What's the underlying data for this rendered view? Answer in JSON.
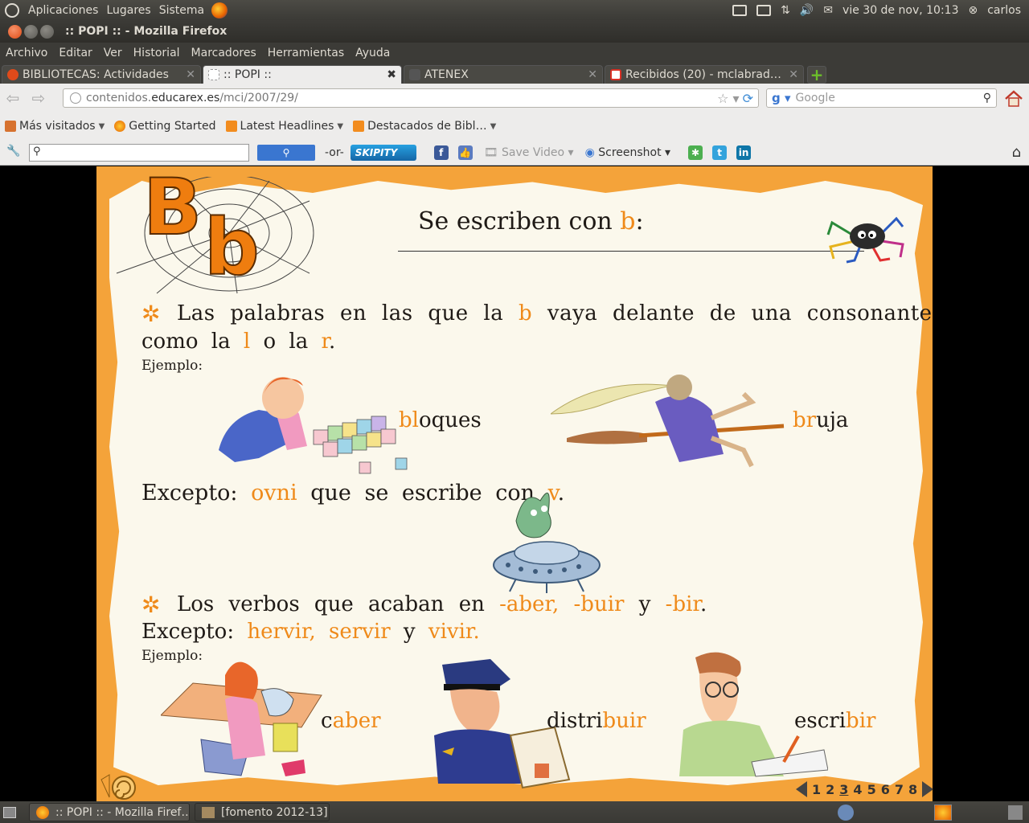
{
  "top_panel": {
    "menus": [
      "Aplicaciones",
      "Lugares",
      "Sistema"
    ],
    "datetime": "vie 30 de nov, 10:13",
    "user": "carlos"
  },
  "window": {
    "title": ":: POPI :: - Mozilla Firefox"
  },
  "menubar": [
    "Archivo",
    "Editar",
    "Ver",
    "Historial",
    "Marcadores",
    "Herramientas",
    "Ayuda"
  ],
  "tabs": [
    {
      "label": "BIBLIOTECAS: Actividades",
      "active": false,
      "favicon_color": "#e04a1a"
    },
    {
      "label": ":: POPI ::",
      "active": true,
      "favicon_color": "#ffffff"
    },
    {
      "label": "ATENEX",
      "active": false,
      "favicon_color": "#555555"
    },
    {
      "label": "Recibidos (20) - mclabrador…",
      "active": false,
      "favicon_color": "#d93025"
    }
  ],
  "navbar": {
    "url_prefix": "contenidos.",
    "url_domain": "educarex.es",
    "url_path": "/mci/2007/29/",
    "search_placeholder": "Google"
  },
  "bookmarks": [
    {
      "label": "Más visitados",
      "icon": "folder-icon",
      "dropdown": true
    },
    {
      "label": "Getting Started",
      "icon": "firefox-icon",
      "dropdown": false
    },
    {
      "label": "Latest Headlines",
      "icon": "rss-icon",
      "dropdown": true
    },
    {
      "label": "Destacados de Bibl…",
      "icon": "rss-icon",
      "dropdown": true
    }
  ],
  "toolbar2": {
    "or_label": "-or-",
    "skipity_label": "SKIPITY",
    "save_video_label": "Save Video",
    "screenshot_label": "Screenshot"
  },
  "lesson": {
    "big_letters": "Bb",
    "heading_prefix": "Se escriben con ",
    "heading_letter": "b",
    "heading_suffix": ":",
    "rule1": {
      "text_a": "Las palabras en las que la ",
      "letter_b": "b",
      "text_b": " vaya delante de una consonante",
      "line2_a": "como la ",
      "letter_l": "l",
      "line2_b": " o la ",
      "letter_r": "r",
      "line2_c": "."
    },
    "ejemplo_label": "Ejemplo:",
    "example_words_1": [
      {
        "highlight": "bl",
        "rest": "oques"
      },
      {
        "highlight": "br",
        "rest": "uja"
      }
    ],
    "exception1": {
      "label": "Excepto:",
      "word": "ovni",
      "text": " que se escribe con ",
      "letter": "v",
      "end": "."
    },
    "rule2": {
      "text": "Los verbos que acaban en ",
      "e1": "-aber,",
      "e2": "-buir",
      "y": "y",
      "e3": "-bir",
      "end": "."
    },
    "exception2": {
      "label": "Excepto:",
      "words": "hervir, servir",
      "y": "y",
      "last": "vivir."
    },
    "example_words_2": [
      {
        "prefix": "c",
        "highlight": "aber"
      },
      {
        "prefix": "distri",
        "highlight": "buir"
      },
      {
        "prefix": "escri",
        "highlight": "bir"
      }
    ],
    "pages": [
      "1",
      "2",
      "3",
      "4",
      "5",
      "6",
      "7",
      "8"
    ],
    "current_page": "3"
  },
  "taskbar": [
    {
      "label": ":: POPI :: - Mozilla Firef…"
    },
    {
      "label": "[fomento 2012-13]"
    }
  ],
  "colors": {
    "accent": "#ef8a1a",
    "frame": "#f4a33a",
    "paper": "#fbf8ec"
  }
}
